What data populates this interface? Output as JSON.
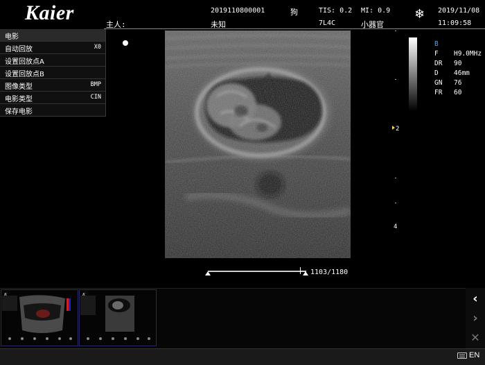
{
  "header": {
    "logo": "Kaier",
    "patient_id": "2019110800001",
    "species": "狗",
    "owner_label": "主人:",
    "owner_value": "未知",
    "tis": "TIS: 0.2",
    "mi": "MI: 0.9",
    "probe": "7L4C",
    "preset": "小器官",
    "date": "2019/11/08",
    "time": "11:09:58",
    "freeze_icon": "snowflake-icon"
  },
  "menu": {
    "title": "电影",
    "items": [
      {
        "label": "自动回放",
        "value": "X0"
      },
      {
        "label": "设置回放点A",
        "value": ""
      },
      {
        "label": "设置回放点B",
        "value": ""
      },
      {
        "label": "图像类型",
        "value": "BMP"
      },
      {
        "label": "电影类型",
        "value": "CIN"
      },
      {
        "label": "保存电影",
        "value": ""
      }
    ]
  },
  "params": {
    "mode": "B",
    "rows": [
      {
        "k": "F",
        "v": "H9.0MHz"
      },
      {
        "k": "DR",
        "v": "90"
      },
      {
        "k": "D",
        "v": "46mm"
      },
      {
        "k": "GN",
        "v": "76"
      },
      {
        "k": "FR",
        "v": "60"
      }
    ]
  },
  "depth_scale": {
    "label_2": "2",
    "label_4": "4"
  },
  "cine": {
    "frame_readout": "1103/1180",
    "position": 0.935
  },
  "statusbar": {
    "language": "EN",
    "keyboard_icon": "keyboard-icon"
  },
  "sidebar_buttons": [
    "chevron-left-icon",
    "chevron-right-icon",
    "close-icon"
  ]
}
